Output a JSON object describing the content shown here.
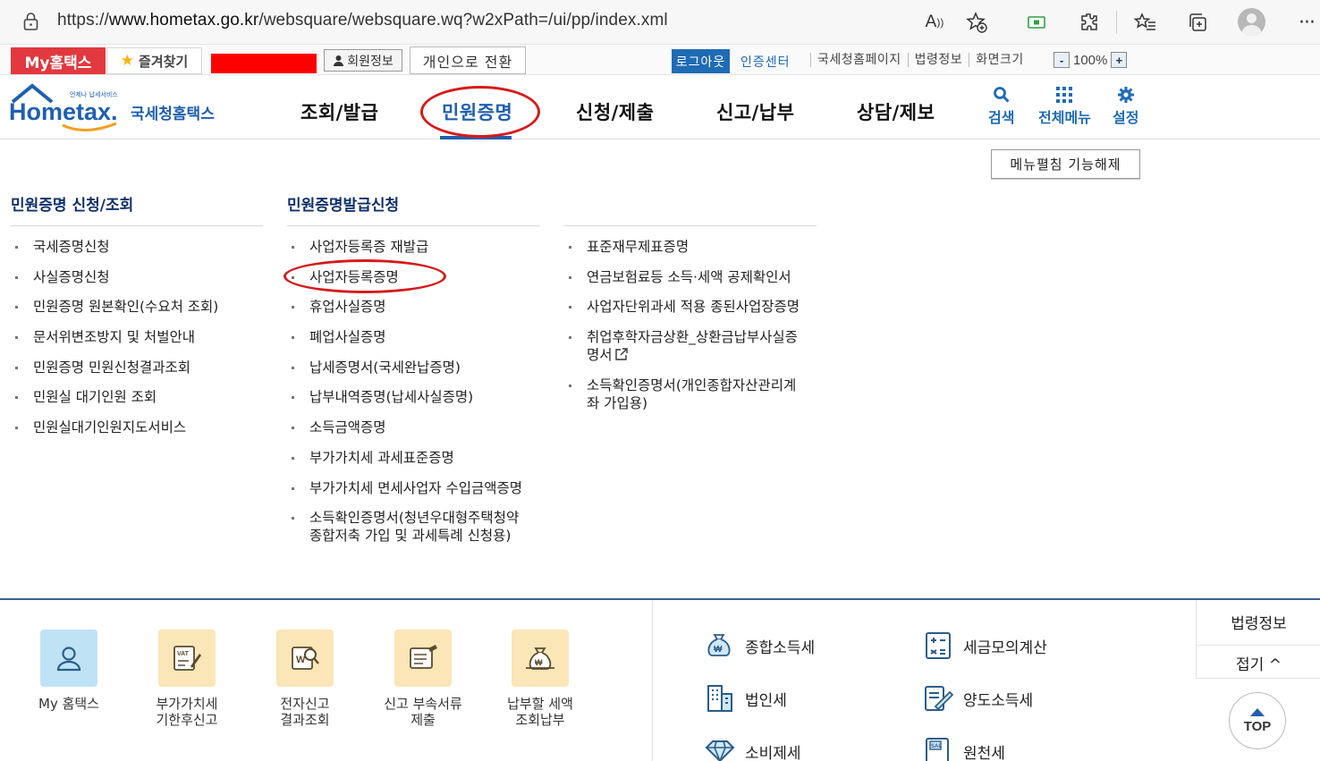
{
  "browser": {
    "url_prefix": "https://",
    "url_host": "www.hometax.go.kr",
    "url_path": "/websquare/websquare.wq?w2xPath=/ui/pp/index.xml",
    "icons": [
      "read-aloud-icon",
      "add-favorite-icon",
      "screen-cast-icon",
      "extensions-icon",
      "favorites-icon",
      "collections-icon",
      "profile-icon",
      "more-icon"
    ]
  },
  "topbar": {
    "my_hometax": "My홈택스",
    "favorites": "즐겨찾기",
    "member_info": "회원정보",
    "switch_personal": "개인으로 전환",
    "logout": "로그아웃",
    "cert_center": "인증센터",
    "links": [
      "국세청홈페이지",
      "법령정보",
      "화면크기"
    ],
    "zoom_value": "100%",
    "zoom_minus": "-",
    "zoom_plus": "+"
  },
  "header": {
    "logo_small": "언제나 납세서비스",
    "logo_main": "Hometax.",
    "logo_sub": "국세청홈택스",
    "gnb": [
      "조회/발급",
      "민원증명",
      "신청/제출",
      "신고/납부",
      "상담/제보"
    ],
    "active_gnb": "민원증명",
    "tools": [
      "검색",
      "전체메뉴",
      "설정"
    ],
    "accent_color": "#1f5fb0",
    "highlight_color": "#d61a1a"
  },
  "megamenu": {
    "unfold_button": "메뉴펼침 기능해제",
    "col1": {
      "title": "민원증명 신청/조회",
      "items": [
        "국세증명신청",
        "사실증명신청",
        "민원증명 원본확인(수요처 조회)",
        "문서위변조방지 및 처벌안내",
        "민원증명 민원신청결과조회",
        "민원실 대기인원 조회",
        "민원실대기인원지도서비스"
      ]
    },
    "col2": {
      "title": "민원증명발급신청",
      "items": [
        "사업자등록증 재발급",
        "사업자등록증명",
        "휴업사실증명",
        "폐업사실증명",
        "납세증명서(국세완납증명)",
        "납부내역증명(납세사실증명)",
        "소득금액증명",
        "부가가치세 과세표준증명",
        "부가가치세 면세사업자 수입금액증명"
      ],
      "item_multiline_1": "소득확인증명서(청년우대형주택청약",
      "item_multiline_2": "종합저축 가입 및 과세특례 신청용)"
    },
    "col3": {
      "items": [
        "표준재무제표증명",
        "연금보험료등 소득·세액 공제확인서",
        "사업자단위과세 적용 종된사업장증명"
      ],
      "item4_line1": "취업후학자금상환_상환금납부사실증",
      "item4_line2": "명서",
      "item5_line1": "소득확인증명서(개인종합자산관리계",
      "item5_line2": "좌 가입용)"
    }
  },
  "bottom": {
    "quick": [
      {
        "line1": "My 홈택스",
        "line2": ""
      },
      {
        "line1": "부가가치세",
        "line2": "기한후신고"
      },
      {
        "line1": "전자신고",
        "line2": "결과조회"
      },
      {
        "line1": "신고 부속서류",
        "line2": "제출"
      },
      {
        "line1": "납부할 세액",
        "line2": "조회납부"
      }
    ],
    "taxes": [
      "종합소득세",
      "세금모의계산",
      "법인세",
      "양도소득세",
      "소비제세",
      "원천세"
    ],
    "side_law": "법령정보",
    "side_fold": "접기 ^",
    "top_button": "TOP"
  }
}
